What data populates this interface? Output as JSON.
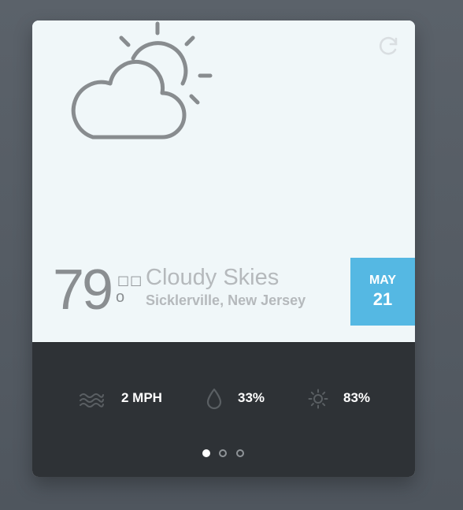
{
  "weather": {
    "icon": "partly-cloudy-icon",
    "temperature": "79",
    "unit_placeholder": "□□",
    "degree_symbol": "o",
    "condition": "Cloudy Skies",
    "location": "Sicklerville, New Jersey"
  },
  "date": {
    "month": "MAY",
    "day": "21"
  },
  "stats": {
    "wind": {
      "icon": "wind-icon",
      "value": "2 MPH"
    },
    "humidity": {
      "icon": "droplet-icon",
      "value": "33%"
    },
    "sun": {
      "icon": "sun-icon",
      "value": "83%"
    }
  },
  "pagination": {
    "total": 3,
    "active_index": 0
  },
  "colors": {
    "accent": "#55b8e3",
    "panel_light": "#f0f7f9",
    "panel_dark": "#2e3236",
    "background": "#555c64",
    "icon_gray": "#8a8e91"
  }
}
